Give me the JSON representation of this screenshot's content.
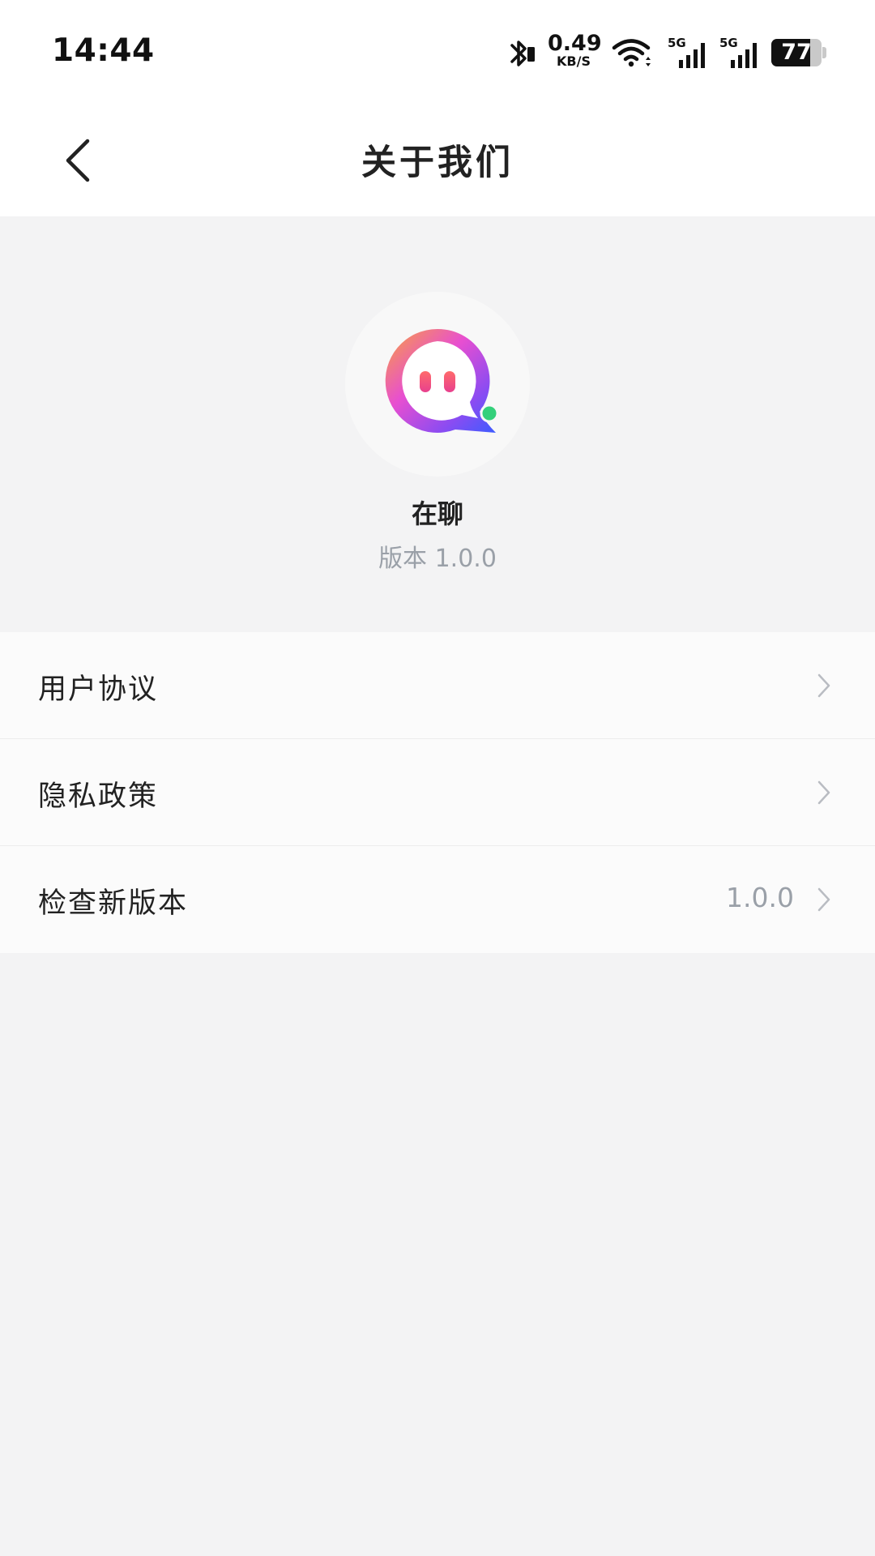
{
  "status_bar": {
    "time": "14:44",
    "net_speed_value": "0.49",
    "net_speed_unit": "KB/S",
    "signal_1_label": "5G",
    "signal_2_label": "5G",
    "battery_level": "77",
    "battery_fraction": 0.77,
    "icons": [
      "bluetooth-icon",
      "wifi-icon",
      "cellular-signal-icon",
      "cellular-signal-icon",
      "battery-icon"
    ]
  },
  "nav": {
    "title": "关于我们",
    "back_icon": "chevron-left-icon"
  },
  "app": {
    "name": "在聊",
    "version": "版本 1.0.0",
    "logo_icon": "chat-bubble-logo-icon",
    "logo_gradient": [
      "#f9a23c",
      "#e84fd0",
      "#6a4cf5",
      "#3d5cff"
    ],
    "online_dot_color": "#34d07b"
  },
  "menu": {
    "items": [
      {
        "label": "用户协议",
        "value": ""
      },
      {
        "label": "隐私政策",
        "value": ""
      },
      {
        "label": "检查新版本",
        "value": "1.0.0"
      }
    ],
    "chevron_icon": "chevron-right-icon"
  },
  "colors": {
    "background": "#f3f3f4",
    "header_background": "#ffffff",
    "secondary_text": "#9aa0a8",
    "primary_text": "#222222"
  }
}
